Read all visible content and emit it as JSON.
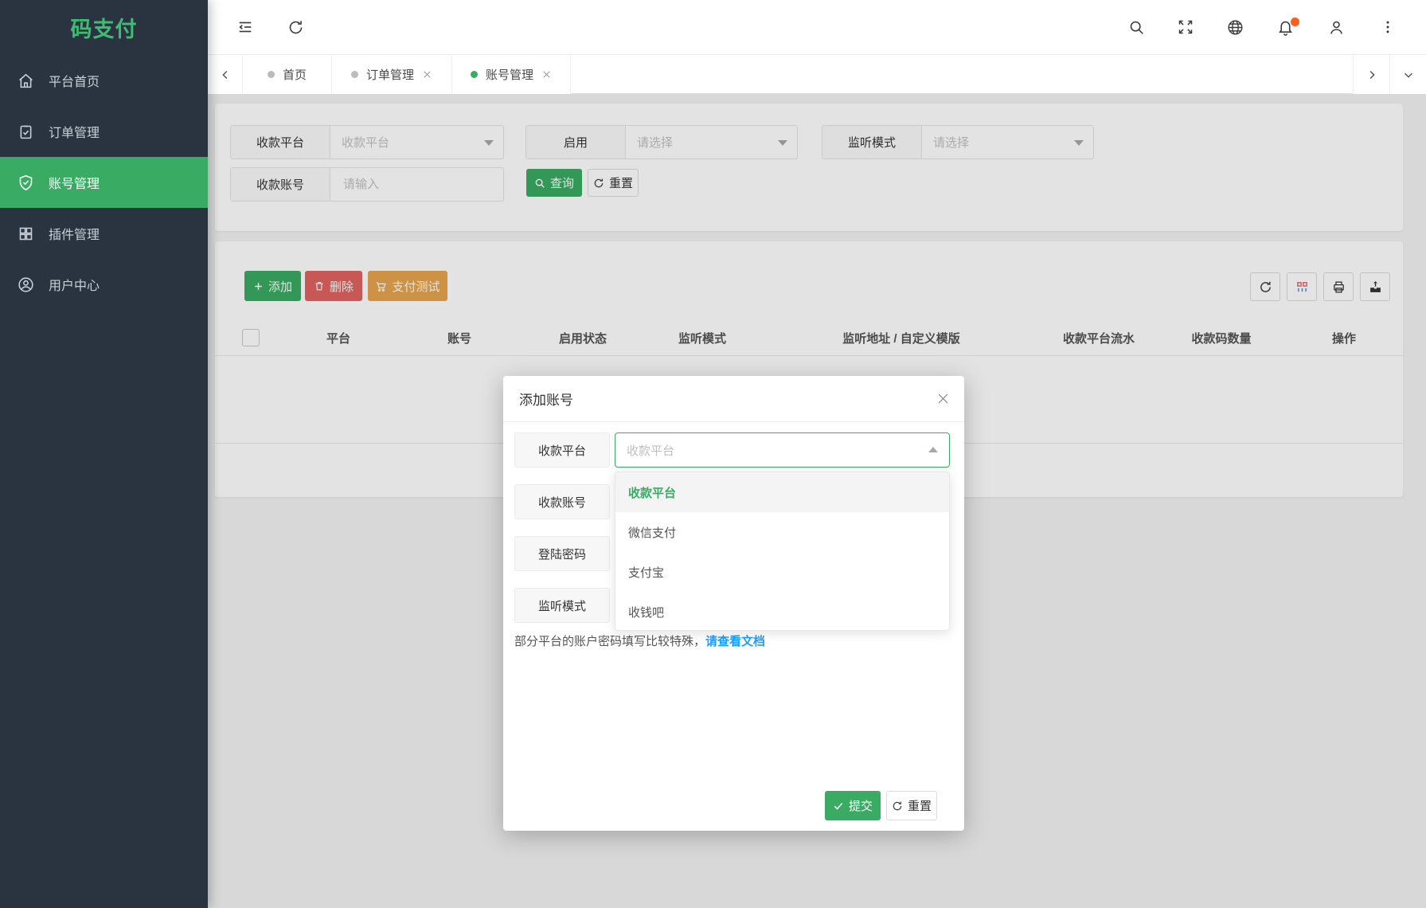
{
  "app": {
    "logo_text": "码支付"
  },
  "sidebar": {
    "items": [
      {
        "label": "平台首页",
        "active": false
      },
      {
        "label": "订单管理",
        "active": false
      },
      {
        "label": "账号管理",
        "active": true
      },
      {
        "label": "插件管理",
        "active": false
      },
      {
        "label": "用户中心",
        "active": false
      }
    ]
  },
  "header": {
    "icons": {
      "collapse": "menu-fold",
      "refresh": "arrow-circle",
      "search": "magnifier",
      "fullscreen": "expand-arrows",
      "language": "globe",
      "notifications": "bell-with-badge",
      "account": "person",
      "more": "kebab-vertical"
    },
    "notification_badge_visible": true
  },
  "tabs": {
    "items": [
      {
        "label": "首页",
        "active": false,
        "closable": false
      },
      {
        "label": "订单管理",
        "active": false,
        "closable": true
      },
      {
        "label": "账号管理",
        "active": true,
        "closable": true
      }
    ]
  },
  "filter": {
    "fields": [
      {
        "label": "收款平台",
        "placeholder": "收款平台",
        "type": "select"
      },
      {
        "label": "启用",
        "placeholder": "请选择",
        "type": "select"
      },
      {
        "label": "监听模式",
        "placeholder": "请选择",
        "type": "select"
      },
      {
        "label": "收款账号",
        "placeholder": "请输入",
        "type": "input"
      }
    ],
    "search": "查询",
    "reset": "重置"
  },
  "toolbar": {
    "add": "添加",
    "delete": "删除",
    "pay_test": "支付测试"
  },
  "table": {
    "columns": [
      "平台",
      "账号",
      "启用状态",
      "监听模式",
      "监听地址 / 自定义模版",
      "收款平台流水",
      "收款码数量",
      "操作"
    ],
    "rows": []
  },
  "modal": {
    "title": "添加账号",
    "rows": [
      "收款平台",
      "收款账号",
      "登陆密码",
      "监听模式"
    ],
    "select_placeholder": "收款平台",
    "options": [
      "收款平台",
      "微信支付",
      "支付宝",
      "收钱吧"
    ],
    "selected_option": "收款平台",
    "note": "部分平台的账户密码填写比较特殊，",
    "note_link": "请查看文档",
    "submit": "提交",
    "reset": "重置"
  },
  "colors": {
    "primary_green": "#3aab62",
    "logo_green": "#3dbd71",
    "danger_red": "#e06361",
    "warning_orange": "#e6a44e",
    "link_blue": "#1e9fff",
    "badge_orange": "#ff5e21",
    "sidebar_bg": "#2a3440"
  }
}
